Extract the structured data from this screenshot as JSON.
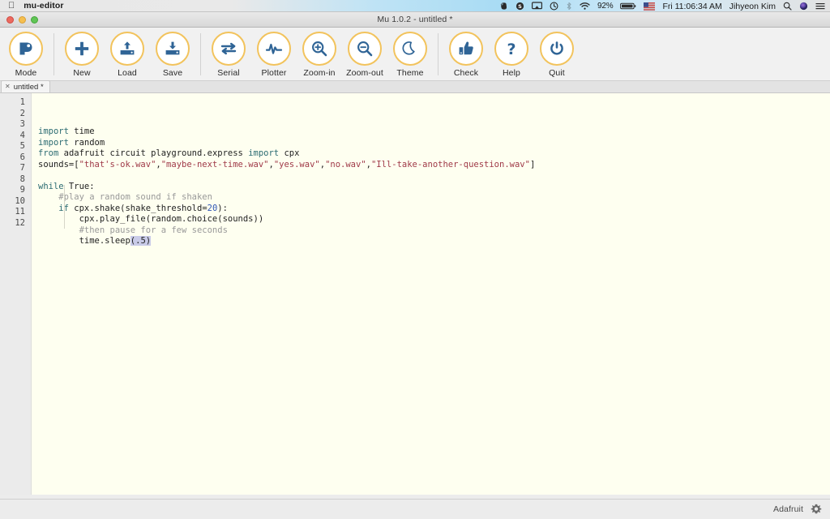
{
  "menubar": {
    "apple_icon": "apple-logo-icon",
    "app_name": "mu-editor",
    "right_items": [
      {
        "name": "evernote-icon",
        "type": "icon"
      },
      {
        "name": "skype-icon",
        "type": "icon"
      },
      {
        "name": "airplay-icon",
        "type": "icon"
      },
      {
        "name": "time-machine-icon",
        "type": "icon"
      },
      {
        "name": "bluetooth-icon",
        "type": "icon",
        "dim": true
      },
      {
        "name": "wifi-icon",
        "type": "icon"
      }
    ],
    "battery_percent": "92%",
    "flag": "us-flag-icon",
    "clock": "Fri 11:06:34 AM",
    "user": "Jihyeon Kim",
    "search_icon": "spotlight-search-icon",
    "siri_icon": "siri-icon",
    "notification_icon": "notification-center-icon"
  },
  "window": {
    "title": "Mu 1.0.2 - untitled *",
    "traffic_lights": [
      "close",
      "minimize",
      "maximize"
    ]
  },
  "toolbar": {
    "groups": [
      {
        "buttons": [
          {
            "label": "Mode",
            "icon": "mode-icon"
          }
        ]
      },
      {
        "buttons": [
          {
            "label": "New",
            "icon": "plus-icon"
          },
          {
            "label": "Load",
            "icon": "load-upload-icon"
          },
          {
            "label": "Save",
            "icon": "save-download-icon"
          }
        ]
      },
      {
        "buttons": [
          {
            "label": "Serial",
            "icon": "serial-arrows-icon"
          },
          {
            "label": "Plotter",
            "icon": "plotter-waveform-icon"
          },
          {
            "label": "Zoom-in",
            "icon": "zoom-in-icon"
          },
          {
            "label": "Zoom-out",
            "icon": "zoom-out-icon"
          },
          {
            "label": "Theme",
            "icon": "moon-theme-icon"
          }
        ]
      },
      {
        "buttons": [
          {
            "label": "Check",
            "icon": "thumbs-up-icon"
          },
          {
            "label": "Help",
            "icon": "question-mark-icon"
          },
          {
            "label": "Quit",
            "icon": "power-icon"
          }
        ]
      }
    ],
    "accent_color": "#f2c35c",
    "icon_color": "#2f6496"
  },
  "tabs": [
    {
      "label": "untitled *",
      "close_icon": "close-icon",
      "active": true
    }
  ],
  "editor": {
    "background": "#fefff0",
    "gutter_background": "#ebebeb",
    "line_numbers": [
      "1",
      "2",
      "3",
      "4",
      "5",
      "6",
      "7",
      "8",
      "9",
      "10",
      "11",
      "12"
    ],
    "lines": [
      {
        "n": 1,
        "tokens": [
          {
            "t": "kw",
            "v": "import"
          },
          {
            "t": "plain",
            "v": " time"
          }
        ]
      },
      {
        "n": 2,
        "tokens": [
          {
            "t": "kw",
            "v": "import"
          },
          {
            "t": "plain",
            "v": " random"
          }
        ]
      },
      {
        "n": 3,
        "tokens": [
          {
            "t": "kw",
            "v": "from"
          },
          {
            "t": "plain",
            "v": " adafruit circuit playground.express "
          },
          {
            "t": "kw",
            "v": "import"
          },
          {
            "t": "plain",
            "v": " cpx"
          }
        ]
      },
      {
        "n": 4,
        "tokens": [
          {
            "t": "plain",
            "v": "sounds=["
          },
          {
            "t": "str",
            "v": "\"that's-ok.wav\""
          },
          {
            "t": "plain",
            "v": ","
          },
          {
            "t": "str",
            "v": "\"maybe-next-time.wav\""
          },
          {
            "t": "plain",
            "v": ","
          },
          {
            "t": "str",
            "v": "\"yes.wav\""
          },
          {
            "t": "plain",
            "v": ","
          },
          {
            "t": "str",
            "v": "\"no.wav\""
          },
          {
            "t": "plain",
            "v": ","
          },
          {
            "t": "str",
            "v": "\"Ill-take-another-question.wav\""
          },
          {
            "t": "plain",
            "v": "]"
          }
        ]
      },
      {
        "n": 5,
        "tokens": []
      },
      {
        "n": 6,
        "tokens": [
          {
            "t": "kw",
            "v": "while"
          },
          {
            "t": "plain",
            "v": " True:"
          }
        ]
      },
      {
        "n": 7,
        "tokens": [
          {
            "t": "com",
            "v": "    #play a random sound if shaken"
          }
        ]
      },
      {
        "n": 8,
        "tokens": [
          {
            "t": "plain",
            "v": "    "
          },
          {
            "t": "kw",
            "v": "if"
          },
          {
            "t": "plain",
            "v": " cpx.shake(shake_threshold="
          },
          {
            "t": "num",
            "v": "20"
          },
          {
            "t": "plain",
            "v": "):"
          }
        ]
      },
      {
        "n": 9,
        "tokens": [
          {
            "t": "plain",
            "v": "        cpx.play_file(random.choice(sounds))"
          }
        ]
      },
      {
        "n": 10,
        "tokens": [
          {
            "t": "com",
            "v": "        #then pause for a few seconds"
          }
        ]
      },
      {
        "n": 11,
        "tokens": [
          {
            "t": "plain",
            "v": "        time.sleep"
          },
          {
            "t": "sel",
            "v": "(.5)"
          }
        ]
      },
      {
        "n": 12,
        "tokens": []
      }
    ],
    "selection_color": "#c9cbe8",
    "token_colors": {
      "keyword": "#2b6b72",
      "string": "#a03a48",
      "comment": "#999999",
      "number": "#2f55b5",
      "plain": "#1f1f1f"
    }
  },
  "statusbar": {
    "mode": "Adafruit",
    "gear_icon": "gear-icon"
  }
}
